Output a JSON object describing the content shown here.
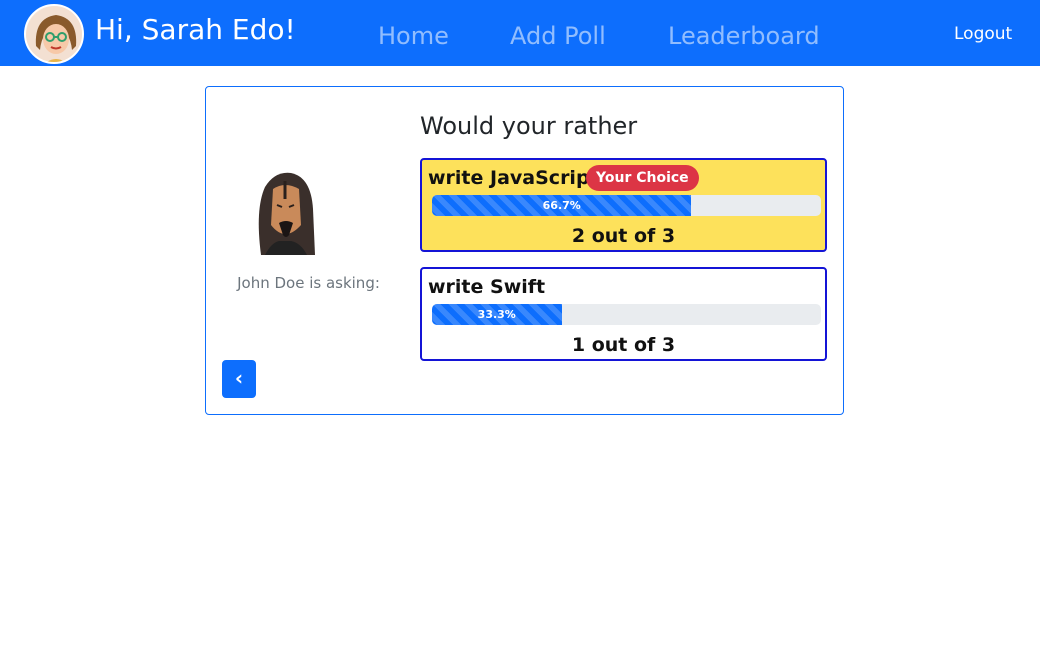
{
  "navbar": {
    "greeting": "Hi, Sarah Edo!",
    "links": {
      "home": "Home",
      "add_poll": "Add Poll",
      "leaderboard": "Leaderboard"
    },
    "logout": "Logout",
    "brand_color": "#0d6efd"
  },
  "question": {
    "author_caption": "John Doe is asking:",
    "title": "Would your rather",
    "options": [
      {
        "text": "write JavaScript",
        "badge": "Your Choice",
        "percent_label": "66.7%",
        "percent": 66.7,
        "votes_label": "2 out of 3",
        "selected": true
      },
      {
        "text": "write Swift",
        "percent_label": "33.3%",
        "percent": 33.3,
        "votes_label": "1 out of 3",
        "selected": false
      }
    ],
    "back_icon": "chevron-left-icon"
  },
  "colors": {
    "selected_option_bg": "#fde15b",
    "option_border": "#1414d6",
    "badge_bg": "#dc3545"
  }
}
